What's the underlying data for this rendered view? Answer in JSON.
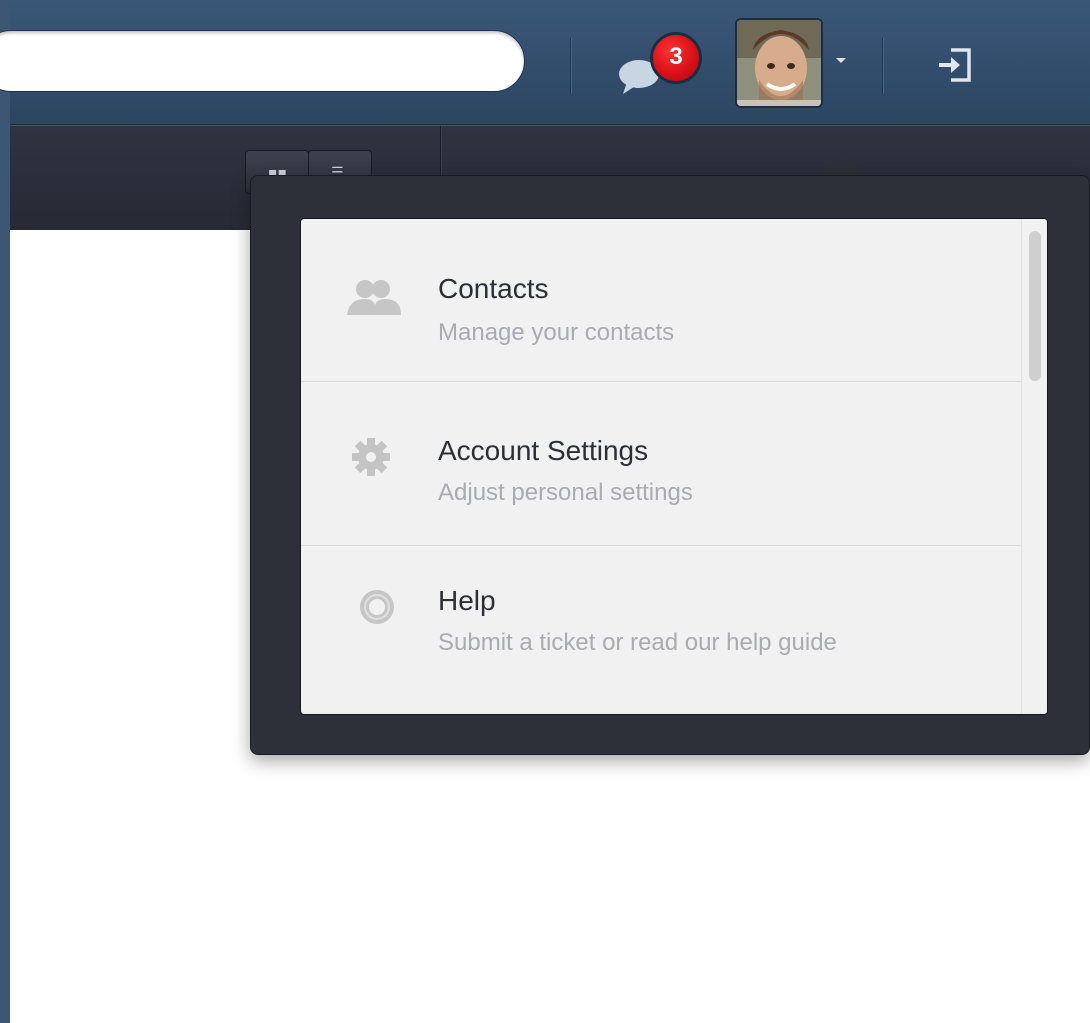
{
  "header": {
    "search": {
      "value": "",
      "placeholder": ""
    },
    "messages": {
      "badge_count": "3"
    },
    "user": {
      "avatar_alt": "User avatar"
    }
  },
  "menu": {
    "items": [
      {
        "title": "Contacts",
        "description": "Manage your contacts",
        "icon": "contacts-icon"
      },
      {
        "title": "Account Settings",
        "description": "Adjust personal settings",
        "icon": "gear-icon"
      },
      {
        "title": "Help",
        "description": "Submit a ticket or read our help guide",
        "icon": "lifebuoy-icon"
      }
    ]
  },
  "colors": {
    "topbar": "#2f4a6a",
    "badge": "#d40f17",
    "dropdown": "#2e3039",
    "panel": "#f1f1f1"
  }
}
